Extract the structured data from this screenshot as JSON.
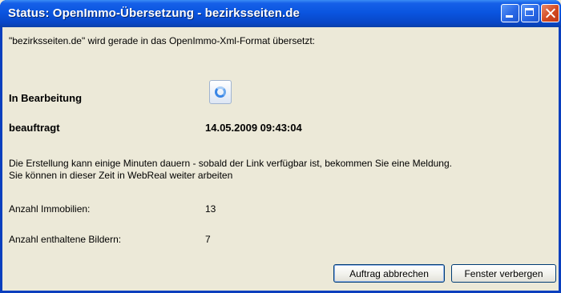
{
  "window": {
    "title": "Status: OpenImmo-Übersetzung - bezirksseiten.de"
  },
  "content": {
    "intro": "\"bezirksseiten.de\" wird gerade in das OpenImmo-Xml-Format übersetzt:",
    "status_label": "In Bearbeitung",
    "ordered_label": "beauftragt",
    "ordered_value": "14.05.2009 09:43:04",
    "info_line1": "Die Erstellung kann einige Minuten dauern - sobald der Link verfügbar ist, bekommen Sie eine Meldung.",
    "info_line2": "Sie können in dieser Zeit in WebReal weiter arbeiten",
    "properties_label": "Anzahl Immobilien:",
    "properties_value": "13",
    "images_label": "Anzahl enthaltene Bildern:",
    "images_value": "7"
  },
  "buttons": {
    "abort": "Auftrag abbrechen",
    "hide": "Fenster verbergen"
  },
  "icons": {
    "status": "loading-spinner-icon"
  }
}
